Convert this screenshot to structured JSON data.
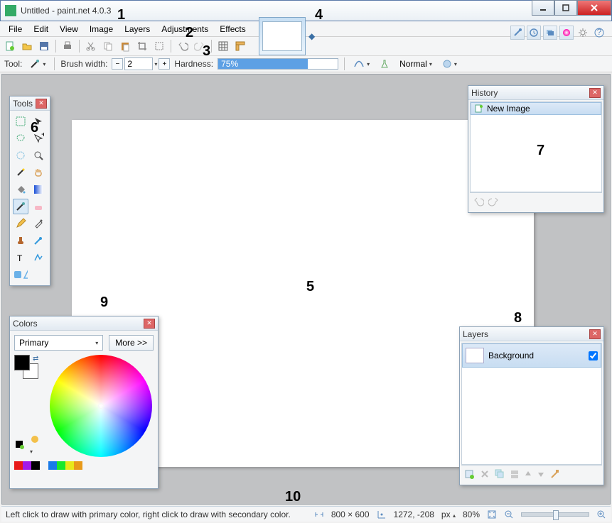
{
  "window": {
    "title": "Untitled - paint.net 4.0.3"
  },
  "menu": {
    "items": [
      "File",
      "Edit",
      "View",
      "Image",
      "Layers",
      "Adjustments",
      "Effects"
    ]
  },
  "toolopts": {
    "tool_label": "Tool:",
    "brush_width_label": "Brush width:",
    "brush_width_value": "2",
    "hardness_label": "Hardness:",
    "hardness_value": "75%",
    "blend_label": "Normal"
  },
  "tools_panel": {
    "title": "Tools"
  },
  "history_panel": {
    "title": "History",
    "items": [
      "New Image"
    ]
  },
  "layers_panel": {
    "title": "Layers",
    "items": [
      {
        "name": "Background",
        "visible": true
      }
    ]
  },
  "colors_panel": {
    "title": "Colors",
    "selector": "Primary",
    "more": "More >>",
    "palette": [
      "#e81a1a",
      "#a31ae8",
      "#000000",
      "#1a7be8",
      "#1ae82b",
      "#e8e81a",
      "#e89a1a"
    ]
  },
  "status": {
    "hint": "Left click to draw with primary color, right click to draw with secondary color.",
    "dims": "800 × 600",
    "cursor": "1272, -208",
    "units": "px",
    "zoom": "80%"
  },
  "annotations": {
    "1": "1",
    "2": "2",
    "3": "3",
    "4": "4",
    "5": "5",
    "6": "6",
    "7": "7",
    "8": "8",
    "9": "9",
    "10": "10"
  }
}
